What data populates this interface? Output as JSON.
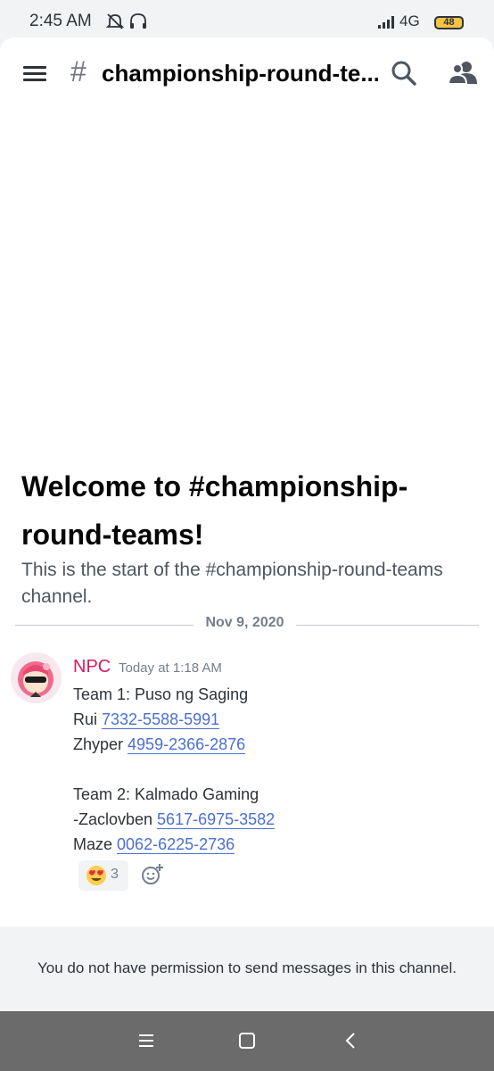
{
  "status_bar": {
    "time": "2:45 AM",
    "network": "4G",
    "battery": "48",
    "icons": [
      "bell-off-icon",
      "headphones-icon",
      "signal-icon"
    ]
  },
  "header": {
    "hash": "#",
    "channel_title": "championship-round-te...",
    "icons": [
      "menu-icon",
      "search-icon",
      "members-icon"
    ]
  },
  "welcome": {
    "title": "Welcome to #championship-round-teams!",
    "subtitle": "This is the start of the #championship-round-teams channel."
  },
  "divider": {
    "date": "Nov 9, 2020"
  },
  "message": {
    "author": "NPC",
    "timestamp": "Today at 1:18 AM",
    "author_color": "#d81b60",
    "lines": [
      {
        "text": "Team 1: Puso ng Saging",
        "link": ""
      },
      {
        "text": "Rui ",
        "link": "7332-5588-5991"
      },
      {
        "text": "Zhyper ",
        "link": "4959-2366-2876"
      },
      {
        "text": "",
        "link": ""
      },
      {
        "text": "Team 2: Kalmado Gaming",
        "link": ""
      },
      {
        "text": "-Zaclovben ",
        "link": "5617-6975-3582"
      },
      {
        "text": "Maze ",
        "link": "0062-6225-2736"
      }
    ],
    "reaction": {
      "emoji": "heart-eyes-emoji",
      "count": "3"
    }
  },
  "permission_notice": "You do not have permission to send messages in this channel.",
  "nav_bar": {
    "icons": [
      "recent-apps-icon",
      "home-icon",
      "back-icon"
    ]
  },
  "colors": {
    "link": "#4a6fd2",
    "background": "#ffffff",
    "chrome": "#f2f3f5"
  }
}
